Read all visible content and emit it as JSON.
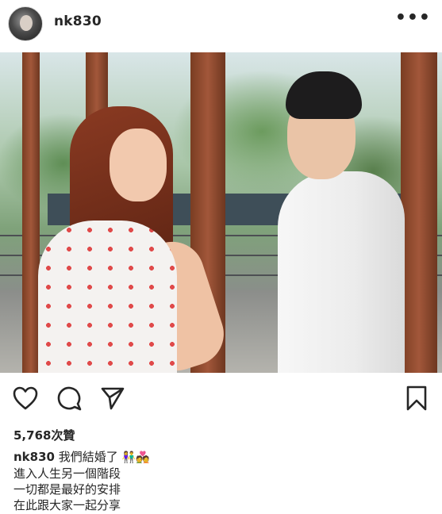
{
  "header": {
    "username": "nk830",
    "more_icon": "more-horizontal-icon"
  },
  "photo": {
    "subject": "couple-photo"
  },
  "actions": {
    "like_icon": "heart-icon",
    "comment_icon": "comment-icon",
    "share_icon": "send-icon",
    "save_icon": "bookmark-icon"
  },
  "likes": {
    "text": "5,768次贊"
  },
  "caption": {
    "username": "nk830",
    "first_line": "我們結婚了",
    "emojis": "👫💑",
    "lines": [
      "進入人生另一個階段",
      "一切都是最好的安排",
      "在此跟大家一起分享"
    ]
  }
}
